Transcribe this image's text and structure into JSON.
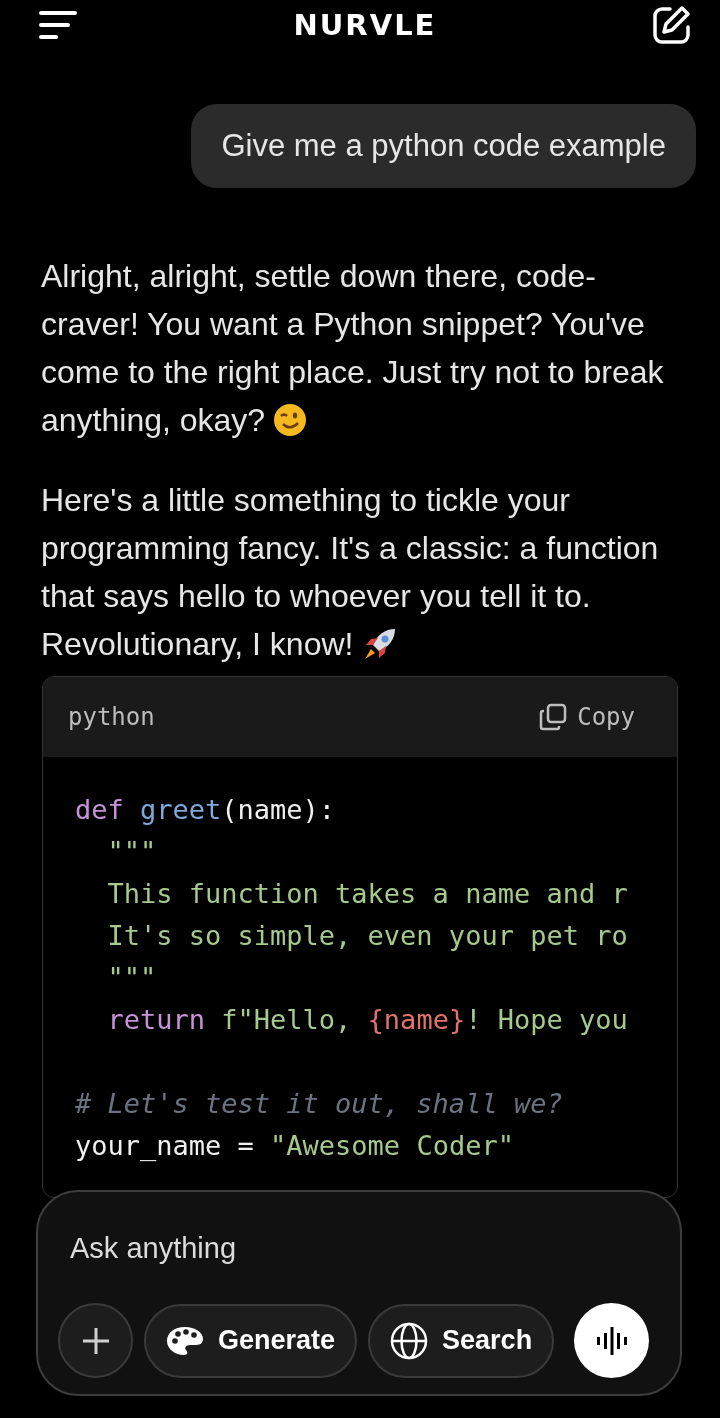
{
  "header": {
    "title": "NURVLE"
  },
  "user_message": {
    "text": "Give me a python code example"
  },
  "reply": {
    "paragraphs": [
      {
        "text": "Alright, alright, settle down there, code-craver! You want a Python snippet? You've come to the right place. Just try not to break anything, okay?",
        "kind": "wink"
      },
      {
        "text": "Here's a little something to tickle your programming fancy. It's a classic: a function that says hello to whoever you tell it to. Revolutionary, I know!",
        "kind": "rocket"
      }
    ],
    "code_block": {
      "language": "python",
      "copy_label": "Copy",
      "lines": [
        {
          "kind": "code",
          "tokens": [
            {
              "kind": "keyword",
              "text": "def"
            },
            {
              "kind": "function",
              "text": " greet"
            },
            {
              "kind": "plain",
              "text": "(name):"
            }
          ]
        },
        {
          "kind": "code",
          "tokens": [
            {
              "kind": "string",
              "text": "  \"\"\""
            }
          ]
        },
        {
          "kind": "code",
          "tokens": [
            {
              "kind": "string",
              "text": "  This function takes a name and r"
            }
          ]
        },
        {
          "kind": "code",
          "tokens": [
            {
              "kind": "string",
              "text": "  It's so simple, even your pet ro"
            }
          ]
        },
        {
          "kind": "code",
          "tokens": [
            {
              "kind": "string",
              "text": "  \"\"\""
            }
          ]
        },
        {
          "kind": "code",
          "tokens": [
            {
              "kind": "keyword",
              "text": "  return"
            },
            {
              "kind": "string",
              "text": " f\"Hello, "
            },
            {
              "kind": "interp",
              "text": "{name}"
            },
            {
              "kind": "string",
              "text": "! Hope you"
            }
          ]
        },
        {
          "kind": "blank"
        },
        {
          "kind": "code",
          "tokens": [
            {
              "kind": "comment",
              "text": "# Let's test it out, shall we?"
            }
          ]
        },
        {
          "kind": "code",
          "tokens": [
            {
              "kind": "plain",
              "text": "your_name = "
            },
            {
              "kind": "string",
              "text": "\"Awesome Coder\""
            }
          ]
        }
      ]
    }
  },
  "composer": {
    "placeholder": "Ask anything",
    "buttons": [
      {
        "kind": "plus"
      },
      {
        "kind": "generate",
        "label": "Generate"
      },
      {
        "kind": "search",
        "label": "Search"
      },
      {
        "kind": "voice"
      }
    ]
  }
}
